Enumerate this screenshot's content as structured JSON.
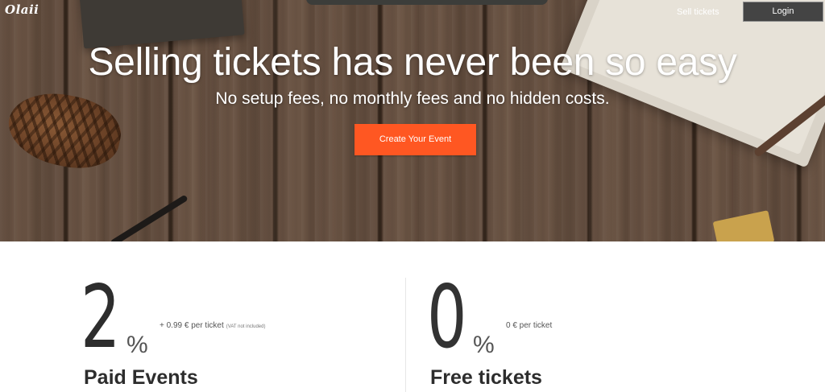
{
  "nav": {
    "logo": "Olaii",
    "sell_tickets": "Sell tickets",
    "login": "Login"
  },
  "hero": {
    "title": "Selling tickets has never been so easy",
    "subtitle": "No setup fees, no monthly fees and no hidden costs.",
    "cta": "Create Your Event"
  },
  "pricing": {
    "paid": {
      "number": "2",
      "percent": "%",
      "note": "+ 0.99 € per ticket",
      "vat": "(VAT not included)",
      "name": "Paid Events"
    },
    "free": {
      "number": "0",
      "percent": "%",
      "note": "0 € per ticket",
      "name": "Free tickets"
    }
  },
  "colors": {
    "cta": "#ff5722",
    "login_button": "#444444"
  }
}
